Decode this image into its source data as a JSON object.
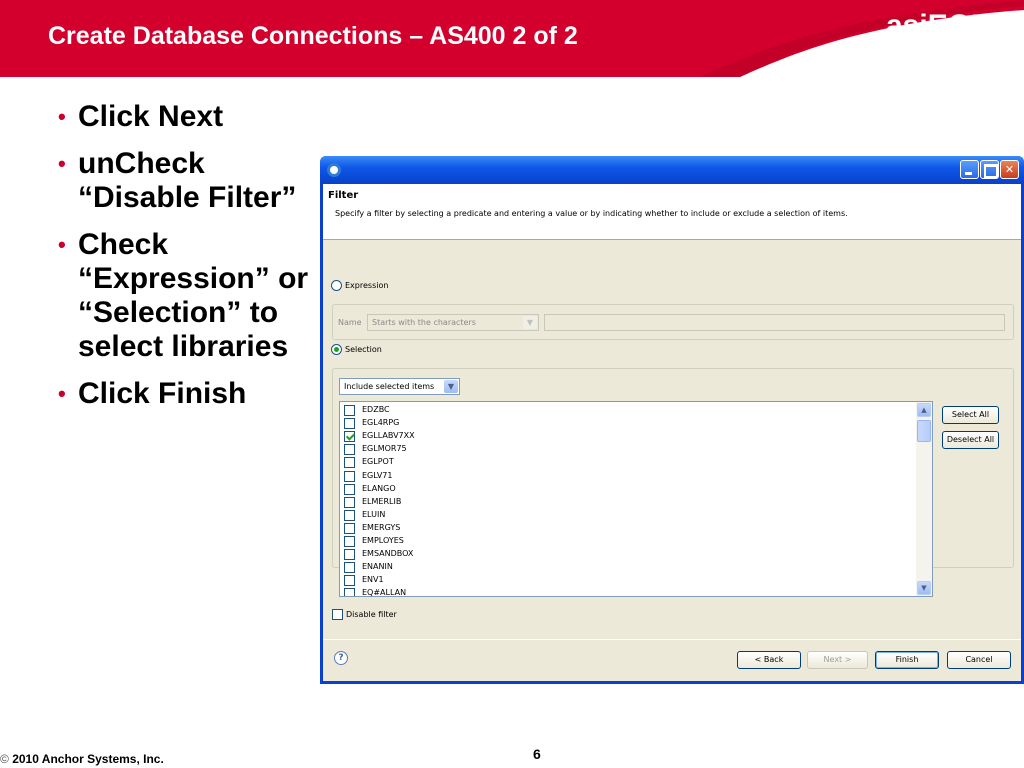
{
  "slide": {
    "title": "Create Database Connections – AS400 2 of 2",
    "brand": "asiEGL",
    "bullets": [
      "Click Next",
      "unCheck “Disable Filter”",
      "Check “Expression” or “Selection” to select libraries",
      "Click Finish"
    ],
    "bullet_glyph": "•",
    "copyright_symbol": "©",
    "copyright": "2010 Anchor Systems, Inc.",
    "page_number": "6",
    "accent_color": "#d3002e"
  },
  "dialog": {
    "window_controls": {
      "minimize_icon": "minimize-icon",
      "maximize_icon": "maximize-icon",
      "close_glyph": "✕"
    },
    "banner": {
      "title": "Filter",
      "description": "Specify a filter by selecting a predicate and entering a value or by indicating whether to include or exclude a selection of items."
    },
    "expression_label": "Expression",
    "name_label": "Name",
    "name_predicate": "Starts with the characters",
    "name_value": "",
    "selection_label": "Selection",
    "include_mode": "Include selected items",
    "combo_arrow": "▼",
    "items": [
      {
        "name": "EDZBC",
        "checked": false
      },
      {
        "name": "EGL4RPG",
        "checked": false
      },
      {
        "name": "EGLLABV7XX",
        "checked": true
      },
      {
        "name": "EGLMOR75",
        "checked": false
      },
      {
        "name": "EGLPOT",
        "checked": false
      },
      {
        "name": "EGLV71",
        "checked": false
      },
      {
        "name": "ELANGO",
        "checked": false
      },
      {
        "name": "ELMERLIB",
        "checked": false
      },
      {
        "name": "ELUIN",
        "checked": false
      },
      {
        "name": "EMERGYS",
        "checked": false
      },
      {
        "name": "EMPLOYES",
        "checked": false
      },
      {
        "name": "EMSANDBOX",
        "checked": false
      },
      {
        "name": "ENANIN",
        "checked": false
      },
      {
        "name": "ENV1",
        "checked": false
      },
      {
        "name": "EQ#ALLAN",
        "checked": false
      }
    ],
    "scroll_up_glyph": "▲",
    "scroll_down_glyph": "▼",
    "select_all_label": "Select All",
    "deselect_all_label": "Deselect All",
    "disable_filter_label": "Disable filter",
    "disable_filter_checked": false,
    "help_glyph": "?",
    "back_label": "< Back",
    "next_label": "Next >",
    "finish_label": "Finish",
    "cancel_label": "Cancel"
  }
}
